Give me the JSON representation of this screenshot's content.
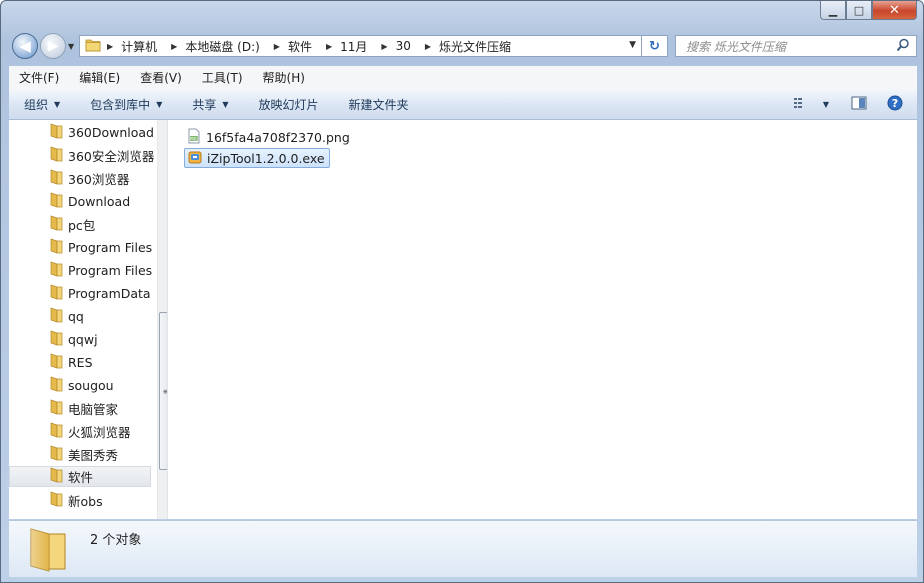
{
  "window": {
    "caption_buttons": {
      "minimize": "▁",
      "maximize": "□",
      "close": "✕"
    }
  },
  "nav": {
    "back_glyph": "◀",
    "forward_glyph": "▶",
    "breadcrumbs": [
      "计算机",
      "本地磁盘 (D:)",
      "软件",
      "11月",
      "30",
      "烁光文件压缩"
    ],
    "search_placeholder": "搜索 烁光文件压缩"
  },
  "menubar": {
    "items": [
      "文件(F)",
      "编辑(E)",
      "查看(V)",
      "工具(T)",
      "帮助(H)"
    ]
  },
  "toolbar": {
    "organize": "组织",
    "include_in_library": "包含到库中",
    "share": "共享",
    "slideshow": "放映幻灯片",
    "new_folder": "新建文件夹"
  },
  "sidebar": {
    "items": [
      {
        "label": "360Download"
      },
      {
        "label": "360安全浏览器"
      },
      {
        "label": "360浏览器"
      },
      {
        "label": "Download"
      },
      {
        "label": "pc包"
      },
      {
        "label": "Program Files"
      },
      {
        "label": "Program Files"
      },
      {
        "label": "ProgramData"
      },
      {
        "label": "qq"
      },
      {
        "label": "qqwj"
      },
      {
        "label": "RES"
      },
      {
        "label": "sougou"
      },
      {
        "label": "电脑管家"
      },
      {
        "label": "火狐浏览器"
      },
      {
        "label": "美图秀秀"
      },
      {
        "label": "软件",
        "selected": true
      },
      {
        "label": "新obs"
      }
    ]
  },
  "files": [
    {
      "name": "16f5fa4a708f2370.png",
      "icon": "png-file-icon"
    },
    {
      "name": "iZipTool1.2.0.0.exe",
      "icon": "exe-file-icon",
      "selected": true
    }
  ],
  "details": {
    "status": "2 个对象"
  },
  "colors": {
    "folder": "#e8c35a",
    "selection_border": "#84acdd",
    "accent": "#2d6ab8"
  }
}
